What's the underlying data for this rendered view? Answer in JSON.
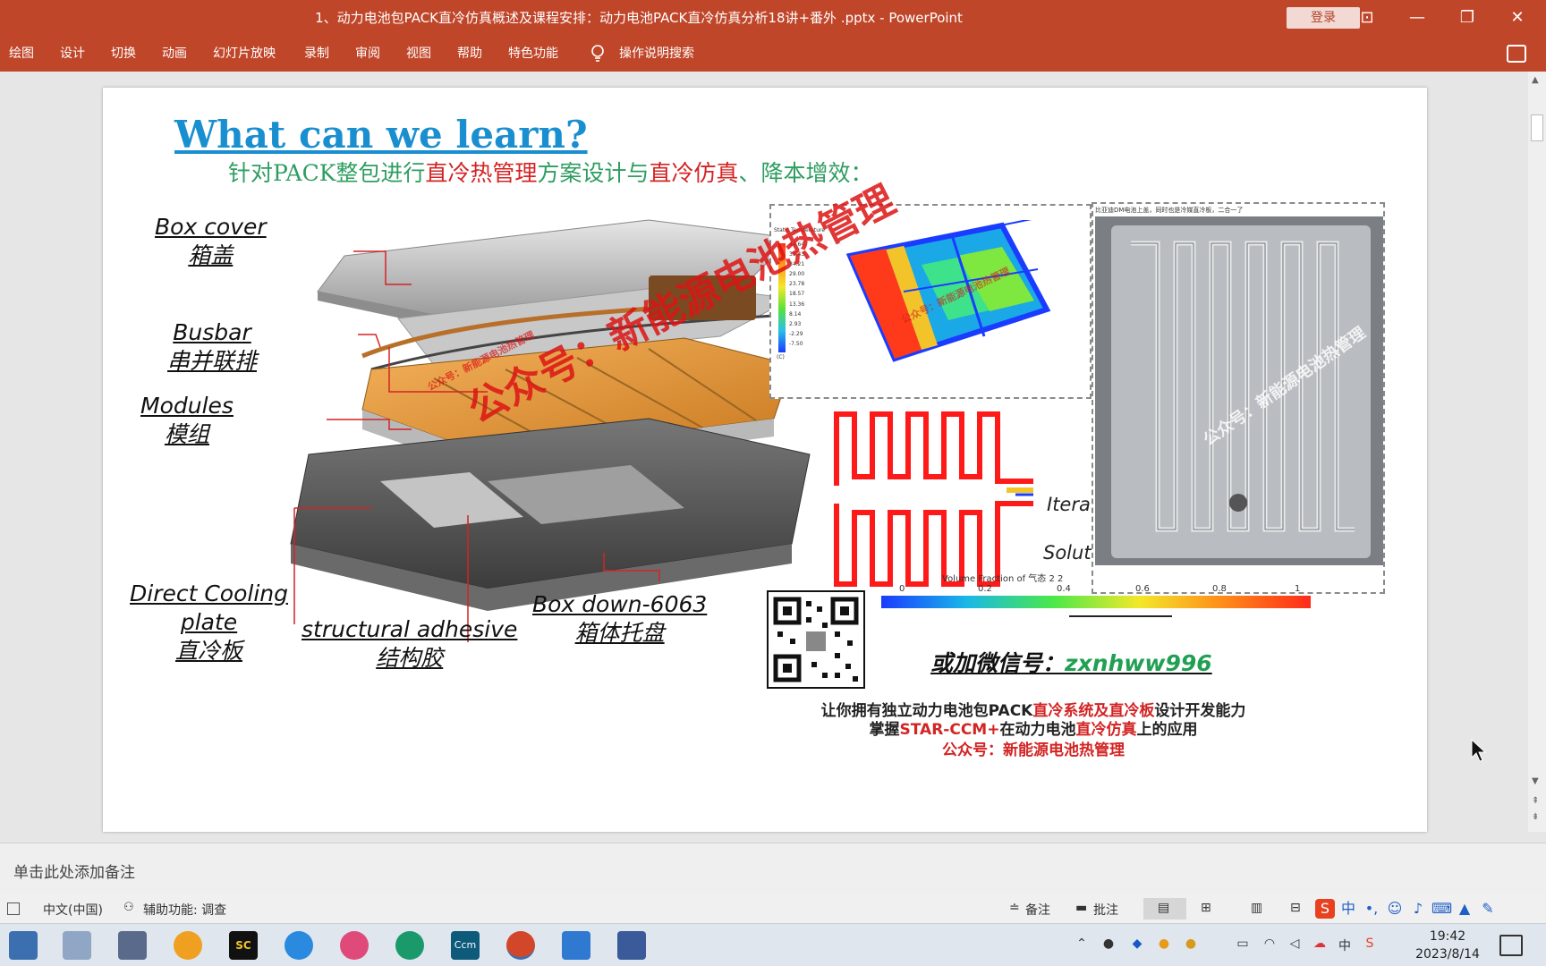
{
  "window": {
    "title": "1、动力电池包PACK直冷仿真概述及课程安排：动力电池PACK直冷仿真分析18讲+番外 .pptx  -  PowerPoint",
    "login_label": "登录",
    "controls": {
      "ribbon_toggle": "⊡",
      "minimize": "—",
      "restore": "❐",
      "close": "✕"
    }
  },
  "ribbon": {
    "tabs": [
      "绘图",
      "设计",
      "切换",
      "动画",
      "幻灯片放映",
      "录制",
      "审阅",
      "视图",
      "帮助",
      "特色功能"
    ],
    "search_label": "操作说明搜索"
  },
  "slide": {
    "title": "What can we learn?",
    "subtitle_parts": [
      {
        "text": "针对PACK整包进行",
        "color": "green"
      },
      {
        "text": "直冷热管理",
        "color": "red"
      },
      {
        "text": "方案设计与",
        "color": "green"
      },
      {
        "text": "直冷仿真",
        "color": "red"
      },
      {
        "text": "、降本增效：",
        "color": "green"
      }
    ],
    "labels": {
      "box_cover_en": "Box cover",
      "box_cover_cn": "箱盖",
      "busbar_en": "Busbar",
      "busbar_cn": "串并联排",
      "modules_en": "Modules",
      "modules_cn": "模组",
      "cooling_en_1": "Direct Cooling",
      "cooling_en_2": "plate",
      "cooling_cn": "直冷板",
      "adhesive_en": "structural adhesive",
      "adhesive_cn": "结构胶",
      "boxdown_en": "Box down-6063",
      "boxdown_cn": "箱体托盘"
    },
    "watermark_big": "公众号：新能源电池热管理",
    "watermark_small": "公众号：新能源电池热管理",
    "photo_watermark": "公众号：新能源电池热管理",
    "contour": {
      "legend_title": "Static Temperature",
      "legend_values": [
        "44.64",
        "39.43",
        "34.21",
        "29.00",
        "23.78",
        "18.57",
        "13.36",
        "8.14",
        "2.93",
        "-2.29",
        "-7.50"
      ],
      "unit": "(C)"
    },
    "cooling_plate": {
      "iter_label": "Itera",
      "solut_label": "Solut",
      "colorbar_title": "Volume Fraction of 气态 2 2",
      "colorbar_ticks": [
        "0",
        "0.2",
        "0.4",
        "0.6",
        "0.8",
        "1"
      ]
    },
    "photo_caption": "比亚迪DM电池上盖，同时也是冷媒直冷板，二合一了",
    "wechat_prefix": "或加微信号：",
    "wechat_id": "zxnhww996",
    "footer1_parts": [
      {
        "text": "让你拥有独立动力电池包PACK",
        "color": "dark"
      },
      {
        "text": "直冷系统及直冷板",
        "color": "red"
      },
      {
        "text": "设计开发能力",
        "color": "dark"
      }
    ],
    "footer2_parts": [
      {
        "text": "掌握",
        "color": "dark"
      },
      {
        "text": "STAR-CCM+",
        "color": "red"
      },
      {
        "text": "在动力电池",
        "color": "dark"
      },
      {
        "text": "直冷仿真",
        "color": "red"
      },
      {
        "text": "上的应用",
        "color": "dark"
      }
    ],
    "footer3": "公众号：新能源电池热管理"
  },
  "notes": {
    "placeholder": "单击此处添加备注"
  },
  "statusbar": {
    "language": "中文(中国)",
    "accessibility": "辅助功能: 调查",
    "notes_btn": "备注",
    "comments_btn": "批注"
  },
  "taskbar": {
    "time": "19:42",
    "date": "2023/8/14",
    "ime_char": "中"
  },
  "colors": {
    "accent": "#c0462a",
    "title_blue": "#1a8fd0",
    "green": "#2e9d60",
    "red": "#d32424"
  }
}
